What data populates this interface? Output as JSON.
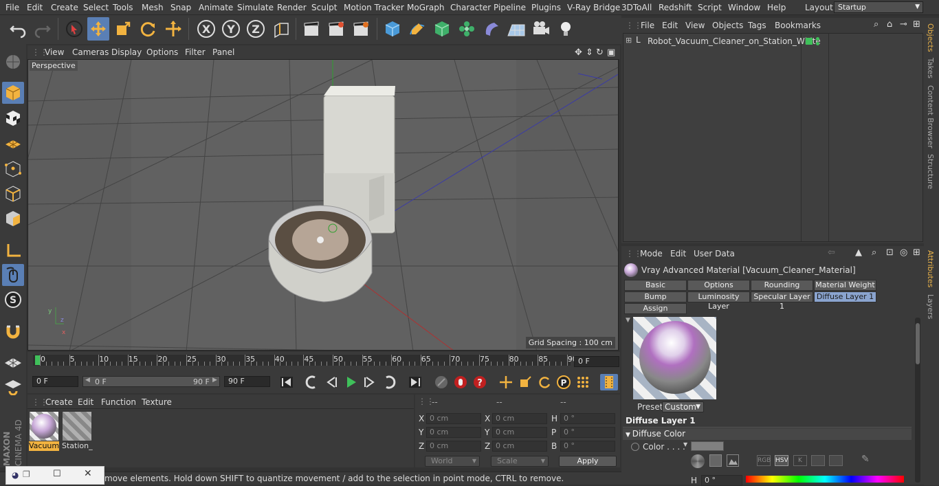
{
  "menu": [
    "File",
    "Edit",
    "Create",
    "Select",
    "Tools",
    "Mesh",
    "Snap",
    "Animate",
    "Simulate",
    "Render",
    "Sculpt",
    "Motion Tracker",
    "MoGraph",
    "Character",
    "Pipeline",
    "Plugins",
    "V-Ray Bridge",
    "3DToAll",
    "Redshift",
    "Script",
    "Window",
    "Help"
  ],
  "layout": {
    "label": "Layout:",
    "value": "Startup"
  },
  "viewport": {
    "menu": [
      "View",
      "Cameras",
      "Display",
      "Options",
      "Filter",
      "Panel"
    ],
    "label": "Perspective",
    "grid_spacing": "Grid Spacing : 100 cm"
  },
  "timeline": {
    "ticks": [
      "0",
      "5",
      "10",
      "15",
      "20",
      "25",
      "30",
      "35",
      "40",
      "45",
      "50",
      "55",
      "60",
      "65",
      "70",
      "75",
      "80",
      "85",
      "90"
    ],
    "current_frame": "0 F",
    "start_frame": "0 F",
    "range_start": "0 F",
    "range_end": "90 F",
    "end_frame": "90 F"
  },
  "materials": {
    "menu": [
      "Create",
      "Edit",
      "Function",
      "Texture"
    ],
    "items": [
      {
        "name": "Vacuum"
      },
      {
        "name": "Station_"
      }
    ]
  },
  "coords": {
    "headers": [
      "--",
      "--",
      "--"
    ],
    "rows": [
      {
        "a": "X",
        "av": "0 cm",
        "b": "X",
        "bv": "0 cm",
        "c": "H",
        "cv": "0 °"
      },
      {
        "a": "Y",
        "av": "0 cm",
        "b": "Y",
        "bv": "0 cm",
        "c": "P",
        "cv": "0 °"
      },
      {
        "a": "Z",
        "av": "0 cm",
        "b": "Z",
        "bv": "0 cm",
        "c": "B",
        "cv": "0 °"
      }
    ],
    "space": "World",
    "mode": "Scale",
    "apply": "Apply"
  },
  "status": "move elements. Hold down SHIFT to quantize movement / add to the selection in point mode, CTRL to remove.",
  "objects": {
    "menu": [
      "File",
      "Edit",
      "View",
      "Objects",
      "Tags",
      "Bookmarks"
    ],
    "items": [
      {
        "name": "Robot_Vacuum_Cleaner_on_Station_White"
      }
    ]
  },
  "side_tabs": [
    "Objects",
    "Takes",
    "Content Browser",
    "Structure",
    "Attributes",
    "Layers"
  ],
  "attributes": {
    "menu": [
      "Mode",
      "Edit",
      "User Data"
    ],
    "title": "Vray Advanced Material [Vacuum_Cleaner_Material]",
    "tabs_row1": [
      "Basic",
      "Options",
      "Rounding",
      "Material Weight"
    ],
    "tabs_row2": [
      "Bump",
      "Luminosity Layer",
      "Specular Layer 1",
      "Diffuse Layer 1"
    ],
    "tabs_row3": [
      "Assign"
    ],
    "preset_label": "Preset",
    "preset_value": "Custom",
    "section": "Diffuse Layer 1",
    "subsection": "Diffuse Color",
    "color_label": "Color . . . .",
    "color_modes": [
      "RGB",
      "HSV",
      "K"
    ],
    "h_label": "H",
    "h_value": "0 °"
  },
  "colors": {
    "accent": "#5a7fb5",
    "active_tab": "#8aa4cf",
    "side_tab_active": "#e8b24a"
  }
}
